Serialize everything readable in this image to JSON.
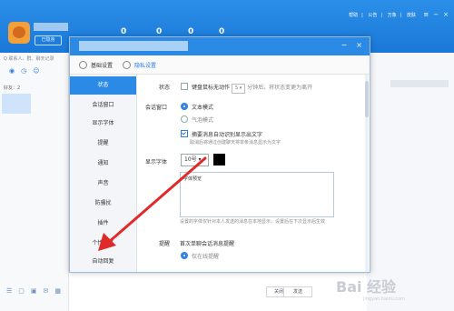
{
  "background_app": {
    "status_badge": "已隐身",
    "counters": [
      "0",
      "0",
      "0",
      "0"
    ],
    "top_links": [
      "帮助",
      "公告",
      "万象",
      "皮肤"
    ],
    "search_placeholder": "Q 联系人、群、聊天记录",
    "friend_count": "好友：2",
    "bottom_close": "关闭",
    "bottom_send": "发送"
  },
  "dialog": {
    "tabs": [
      "基础设置",
      "隐私设置"
    ],
    "nav_items": [
      "状态",
      "会话窗口",
      "显示字体",
      "提醒",
      "通知",
      "声音",
      "防骚扰",
      "插件",
      "个性签名",
      "自动回复"
    ],
    "active_nav_index": 0,
    "status": {
      "label": "状态",
      "idle_label": "键盘鼠标无动作",
      "idle_minutes": "5",
      "idle_suffix": "分钟后，将状态变更为离开"
    },
    "session": {
      "label": "会话窗口",
      "option_text": "文本模式",
      "option_bubble": "气泡模式",
      "auto_display": "摘要消息自动识别显示出文字",
      "hint": "取消后将通过创建聊天将单条消息显示为文字"
    },
    "font": {
      "label": "显示字体",
      "size": "10号",
      "color": "#000000",
      "preview": "字体预览",
      "note": "设置的字体仅针对本人发送的消息在本地显示，设置后在下次显示后生效"
    },
    "remind": {
      "label": "提醒",
      "text": "首次单聊会话消息提醒",
      "sub": "仅在线提醒"
    }
  },
  "watermark": {
    "brand": "Bai 经验",
    "url": "jingyan.baidu.com"
  }
}
